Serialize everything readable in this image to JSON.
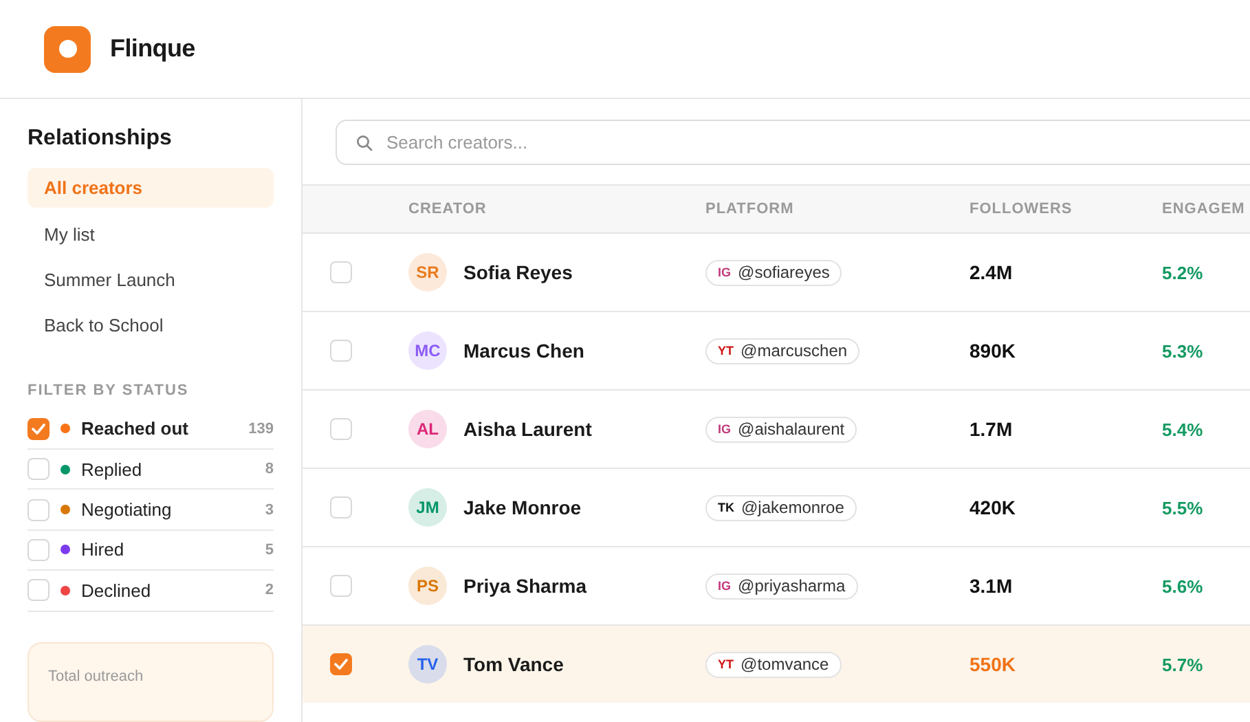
{
  "brand": {
    "name": "Flinque"
  },
  "sidebar": {
    "title": "Relationships",
    "items": [
      {
        "label": "All creators",
        "selected": true
      },
      {
        "label": "My list",
        "selected": false
      },
      {
        "label": "Summer Launch",
        "selected": false
      },
      {
        "label": "Back to School",
        "selected": false
      }
    ],
    "filter_title": "FILTER BY STATUS",
    "filters": [
      {
        "label": "Reached out",
        "count": "139",
        "checked": true,
        "color": "#f97316"
      },
      {
        "label": "Replied",
        "count": "8",
        "checked": false,
        "color": "#059669"
      },
      {
        "label": "Negotiating",
        "count": "3",
        "checked": false,
        "color": "#d97706"
      },
      {
        "label": "Hired",
        "count": "5",
        "checked": false,
        "color": "#7c3aed"
      },
      {
        "label": "Declined",
        "count": "2",
        "checked": false,
        "color": "#ef4444"
      }
    ],
    "summary": {
      "label": "Total outreach"
    }
  },
  "search": {
    "placeholder": "Search creators..."
  },
  "table": {
    "columns": [
      "CREATOR",
      "PLATFORM",
      "FOLLOWERS",
      "ENGAGEM"
    ],
    "rows": [
      {
        "initials": "SR",
        "name": "Sofia Reyes",
        "color": "#ea7a1e",
        "platform": "IG",
        "kind": "ig",
        "handle": "@sofiareyes",
        "followers": "2.4M",
        "engagement": "5.2%",
        "selected": false
      },
      {
        "initials": "MC",
        "name": "Marcus Chen",
        "color": "#8b5cf6",
        "platform": "YT",
        "kind": "yt",
        "handle": "@marcuschen",
        "followers": "890K",
        "engagement": "5.3%",
        "selected": false
      },
      {
        "initials": "AL",
        "name": "Aisha Laurent",
        "color": "#db2777",
        "platform": "IG",
        "kind": "ig",
        "handle": "@aishalaurent",
        "followers": "1.7M",
        "engagement": "5.4%",
        "selected": false
      },
      {
        "initials": "JM",
        "name": "Jake Monroe",
        "color": "#059669",
        "platform": "TK",
        "kind": "tk",
        "handle": "@jakemonroe",
        "followers": "420K",
        "engagement": "5.5%",
        "selected": false
      },
      {
        "initials": "PS",
        "name": "Priya Sharma",
        "color": "#d97706",
        "platform": "IG",
        "kind": "ig",
        "handle": "@priyasharma",
        "followers": "3.1M",
        "engagement": "5.6%",
        "selected": false
      },
      {
        "initials": "TV",
        "name": "Tom Vance",
        "color": "#2563eb",
        "platform": "YT",
        "kind": "yt",
        "handle": "@tomvance",
        "followers": "550K",
        "engagement": "5.7%",
        "selected": true
      }
    ]
  }
}
